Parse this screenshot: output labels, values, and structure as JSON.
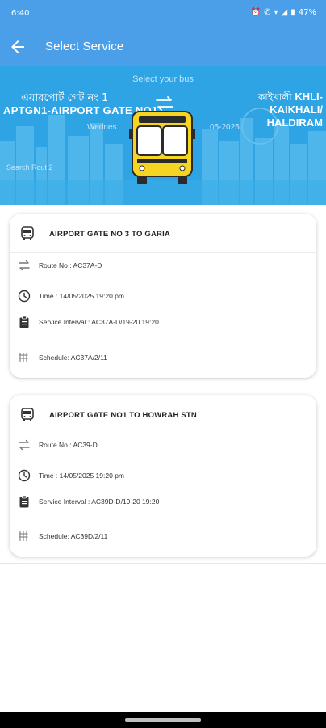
{
  "status_bar": {
    "time": "6:40",
    "battery": "47%"
  },
  "app_bar": {
    "title": "Select Service"
  },
  "hero": {
    "select_link": "Select your bus",
    "from_bengali": "এয়ারপোর্ট গেট নং 1",
    "from_english": "APTGN1-AIRPORT GATE NO1",
    "to_bengali": "কাইখালী",
    "to_english_line1": "KHLI-KAIKHALI/",
    "to_english_line2": "HALDIRAM",
    "date_left": "Wednes",
    "date_right": "05-2025",
    "search_text": "Search Rout 2"
  },
  "services": [
    {
      "title": "AIRPORT GATE NO 3 TO GARIA",
      "route_no": "Route No : AC37A-D",
      "time": "Time : 14/05/2025 19:20 pm",
      "service_interval": "Service Interval : AC37A-D/19-20 19:20",
      "schedule": "Schedule: AC37A/2/11"
    },
    {
      "title": "AIRPORT GATE NO1 TO HOWRAH STN",
      "route_no": "Route No : AC39-D",
      "time": "Time : 14/05/2025 19:20 pm",
      "service_interval": "Service Interval : AC39D-D/19-20 19:20",
      "schedule": "Schedule: AC39D/2/11"
    }
  ],
  "colors": {
    "primary": "#4a9fe8",
    "hero_bg": "#2ea4e4",
    "bus_yellow": "#f5d422"
  }
}
